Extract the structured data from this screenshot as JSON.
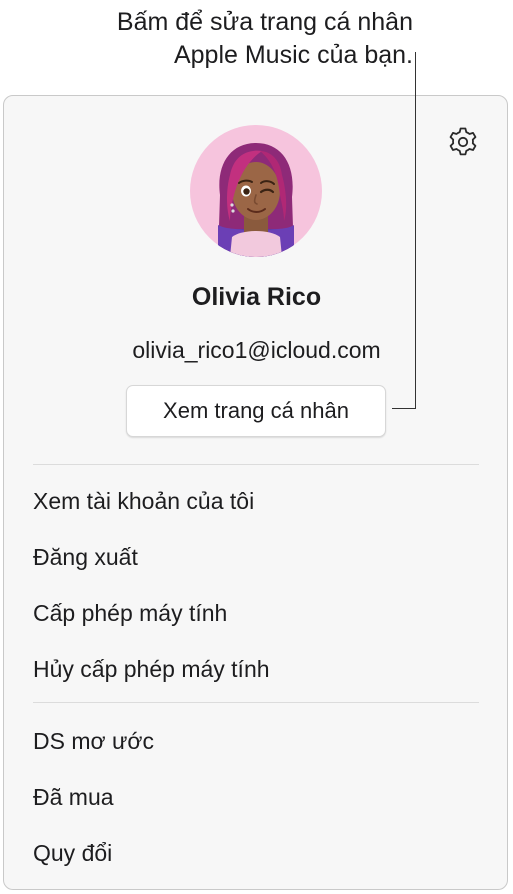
{
  "callout": {
    "line1": "Bấm để sửa trang cá nhân",
    "line2": "Apple Music của bạn."
  },
  "account": {
    "name": "Olivia Rico",
    "email": "olivia_rico1@icloud.com",
    "view_profile_label": "Xem trang cá nhân"
  },
  "menu": {
    "account_group": [
      {
        "label": "Xem tài khoản của tôi"
      },
      {
        "label": "Đăng xuất"
      },
      {
        "label": "Cấp phép máy tính"
      },
      {
        "label": "Hủy cấp phép máy tính"
      }
    ],
    "store_group": [
      {
        "label": "DS mơ ước"
      },
      {
        "label": "Đã mua"
      },
      {
        "label": "Quy đổi"
      }
    ]
  },
  "icons": {
    "settings": "gear-icon",
    "avatar": "memoji-avatar"
  },
  "colors": {
    "panel_background": "#f7f7f7",
    "avatar_background": "#f6c4dd",
    "text": "#1d1d1f"
  }
}
